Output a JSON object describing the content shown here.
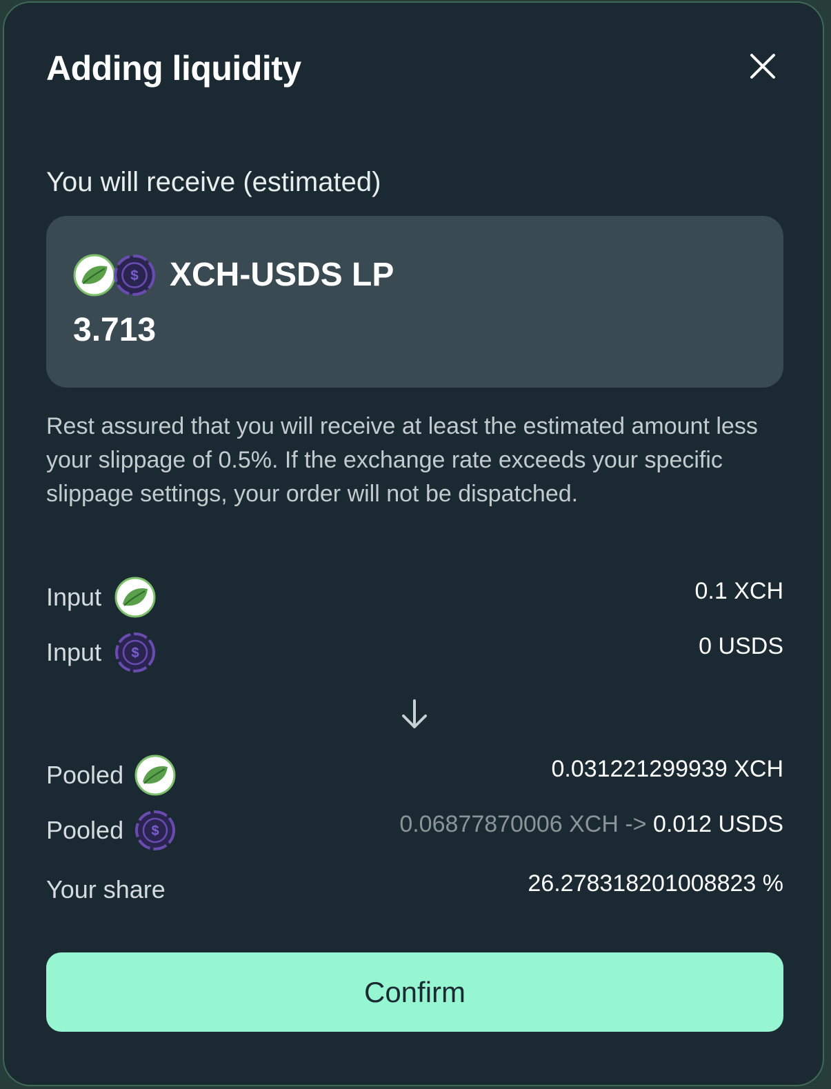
{
  "modal": {
    "title": "Adding liquidity",
    "close_icon": "close-icon"
  },
  "receive": {
    "label": "You will receive (estimated)",
    "token_name": "XCH-USDS LP",
    "amount": "3.713",
    "icons": [
      "xch-leaf-icon",
      "usds-dollar-icon"
    ]
  },
  "note": "Rest assured that you will receive at least the estimated amount less your slippage of 0.5%. If the exchange rate exceeds your specific slippage settings, your order will not be dispatched.",
  "inputs": [
    {
      "label": "Input",
      "icon": "xch-leaf-icon",
      "value": "0.1 XCH"
    },
    {
      "label": "Input",
      "icon": "usds-dollar-icon",
      "value": "0 USDS"
    }
  ],
  "arrow_icon": "arrow-down-icon",
  "pooled": [
    {
      "label": "Pooled",
      "icon": "xch-leaf-icon",
      "value": "0.031221299939 XCH"
    },
    {
      "label": "Pooled",
      "icon": "usds-dollar-icon",
      "value_prefix": "0.06877870006 XCH ->",
      "value": "0.012 USDS"
    }
  ],
  "share": {
    "label": "Your share",
    "value": "26.278318201008823 %"
  },
  "confirm_label": "Confirm",
  "colors": {
    "modal_bg": "#1b2a32",
    "card_bg": "#3a4a53",
    "confirm_bg": "#97f6d2",
    "xch_green": "#5aa04a",
    "usds_purple": "#6a4bb0"
  }
}
